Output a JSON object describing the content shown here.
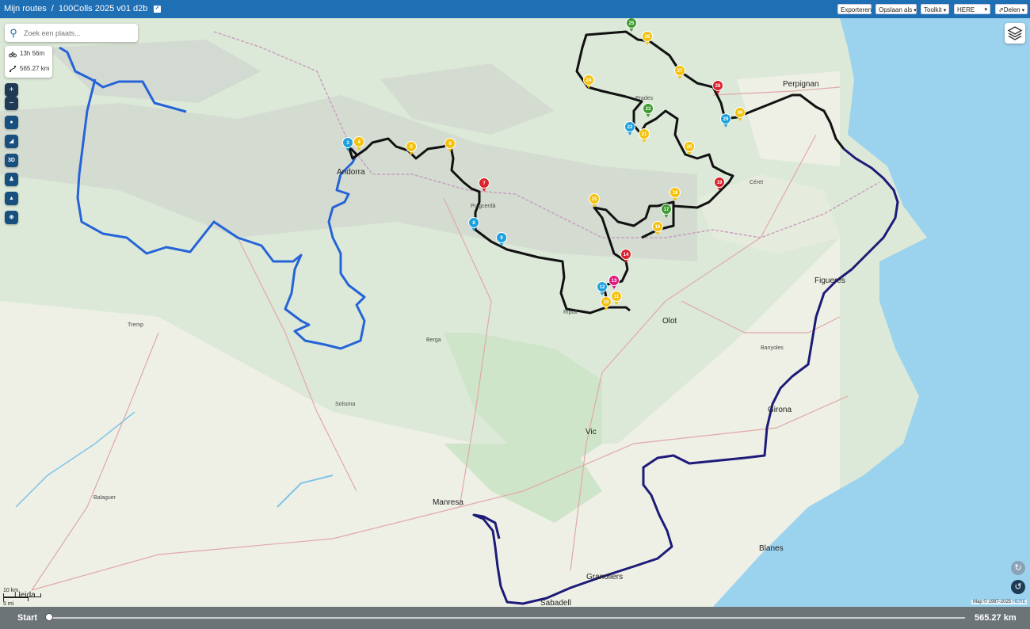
{
  "topbar": {
    "breadcrumb_root": "Mijn routes",
    "separator": "/",
    "route_name": "100Colls 2025 v01 d2b",
    "buttons": {
      "export": "Exporteren",
      "save_as": "Opslaan als",
      "toolkit": "Toolkit",
      "map_provider": "HERE",
      "share": "Delen"
    }
  },
  "search": {
    "placeholder": "Zoek een plaats..."
  },
  "stats": {
    "duration": "13h 56m",
    "distance": "565.27 km"
  },
  "controls": {
    "zoom_in": "+",
    "zoom_out": "−",
    "view_3d": "3D"
  },
  "scale": {
    "metric": "10 km",
    "imperial": "5 mi"
  },
  "credit": {
    "text": "Map © 1987-2025",
    "brand": "HERE"
  },
  "bottom": {
    "start_label": "Start",
    "total_distance": "565.27 km",
    "progress": 0
  },
  "colors": {
    "topbar": "#1f6fb5",
    "route_black": "#111111",
    "route_blue": "#2563d8",
    "route_navy": "#1e1b78",
    "marker_yellow": "#f4c20d",
    "marker_red": "#d9232d",
    "marker_green": "#3c9a2e",
    "marker_blue": "#1ea0dc",
    "marker_magenta": "#e0197a"
  },
  "places": {
    "perpignan": "Perpignan",
    "girona": "Girona",
    "lleida": "Lleida",
    "manresa": "Manresa",
    "sabadell": "Sabadell",
    "granollers": "Granollers",
    "vic": "Vic",
    "olot": "Olot",
    "figueres": "Figueres",
    "tremp": "Tremp",
    "andorra": "Andorra",
    "puigcerda": "Puigcerdà",
    "ceret": "Céret",
    "blanes": "Blanes",
    "balaguer": "Balaguer",
    "solsona": "Solsona",
    "berga": "Berga",
    "ripoll": "Ripoll",
    "prades": "Prades",
    "banyoles": "Banyoles"
  },
  "markers": [
    "3",
    "4",
    "5",
    "6",
    "7",
    "8",
    "9",
    "10",
    "11",
    "12",
    "13",
    "14",
    "15",
    "16",
    "17",
    "18",
    "19",
    "20",
    "21",
    "22",
    "23",
    "24",
    "25",
    "26",
    "27",
    "28",
    "29",
    "30"
  ]
}
